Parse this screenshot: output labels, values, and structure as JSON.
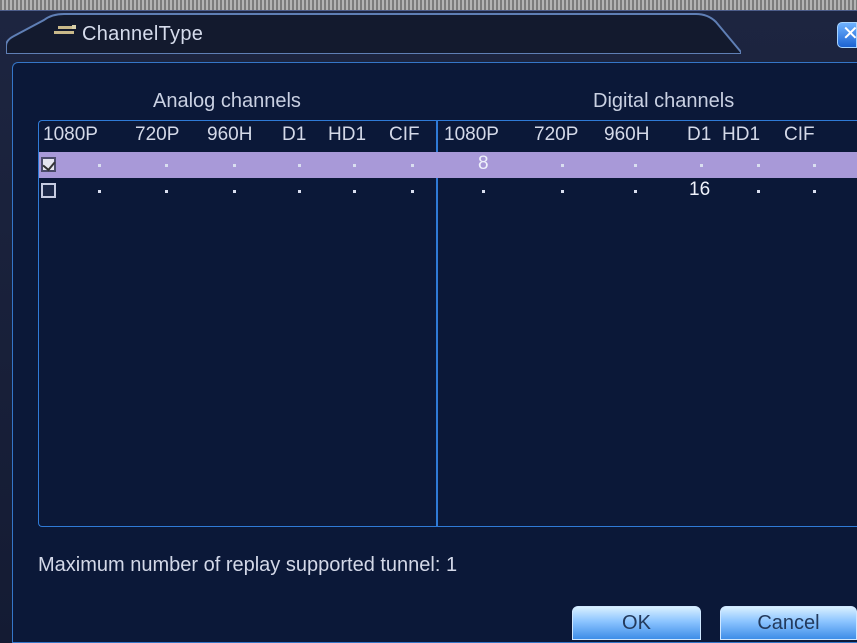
{
  "window": {
    "title": "ChannelType",
    "close_glyph": "✕"
  },
  "sections": {
    "analog_title": "Analog channels",
    "digital_title": "Digital channels"
  },
  "columns": {
    "analog": [
      "1080P",
      "720P",
      "960H",
      "D1",
      "HD1",
      "CIF"
    ],
    "digital": [
      "1080P",
      "720P",
      "960H",
      "D1",
      "HD1",
      "CIF"
    ]
  },
  "rows": [
    {
      "checked": true,
      "selected": true,
      "analog": [
        ".",
        ".",
        ".",
        ".",
        ".",
        "."
      ],
      "digital": [
        "8",
        ".",
        ".",
        ".",
        ".",
        "."
      ]
    },
    {
      "checked": false,
      "selected": false,
      "analog": [
        ".",
        ".",
        ".",
        ".",
        ".",
        "."
      ],
      "digital": [
        ".",
        ".",
        ".",
        "16",
        ".",
        "."
      ]
    }
  ],
  "footer": {
    "replay_text": "Maximum number of replay supported tunnel: 1"
  },
  "buttons": {
    "ok": "OK",
    "cancel": "Cancel"
  },
  "colors": {
    "selected_row": "#a899d8",
    "border_accent": "#2f7ad6",
    "background": "#0b1838"
  }
}
